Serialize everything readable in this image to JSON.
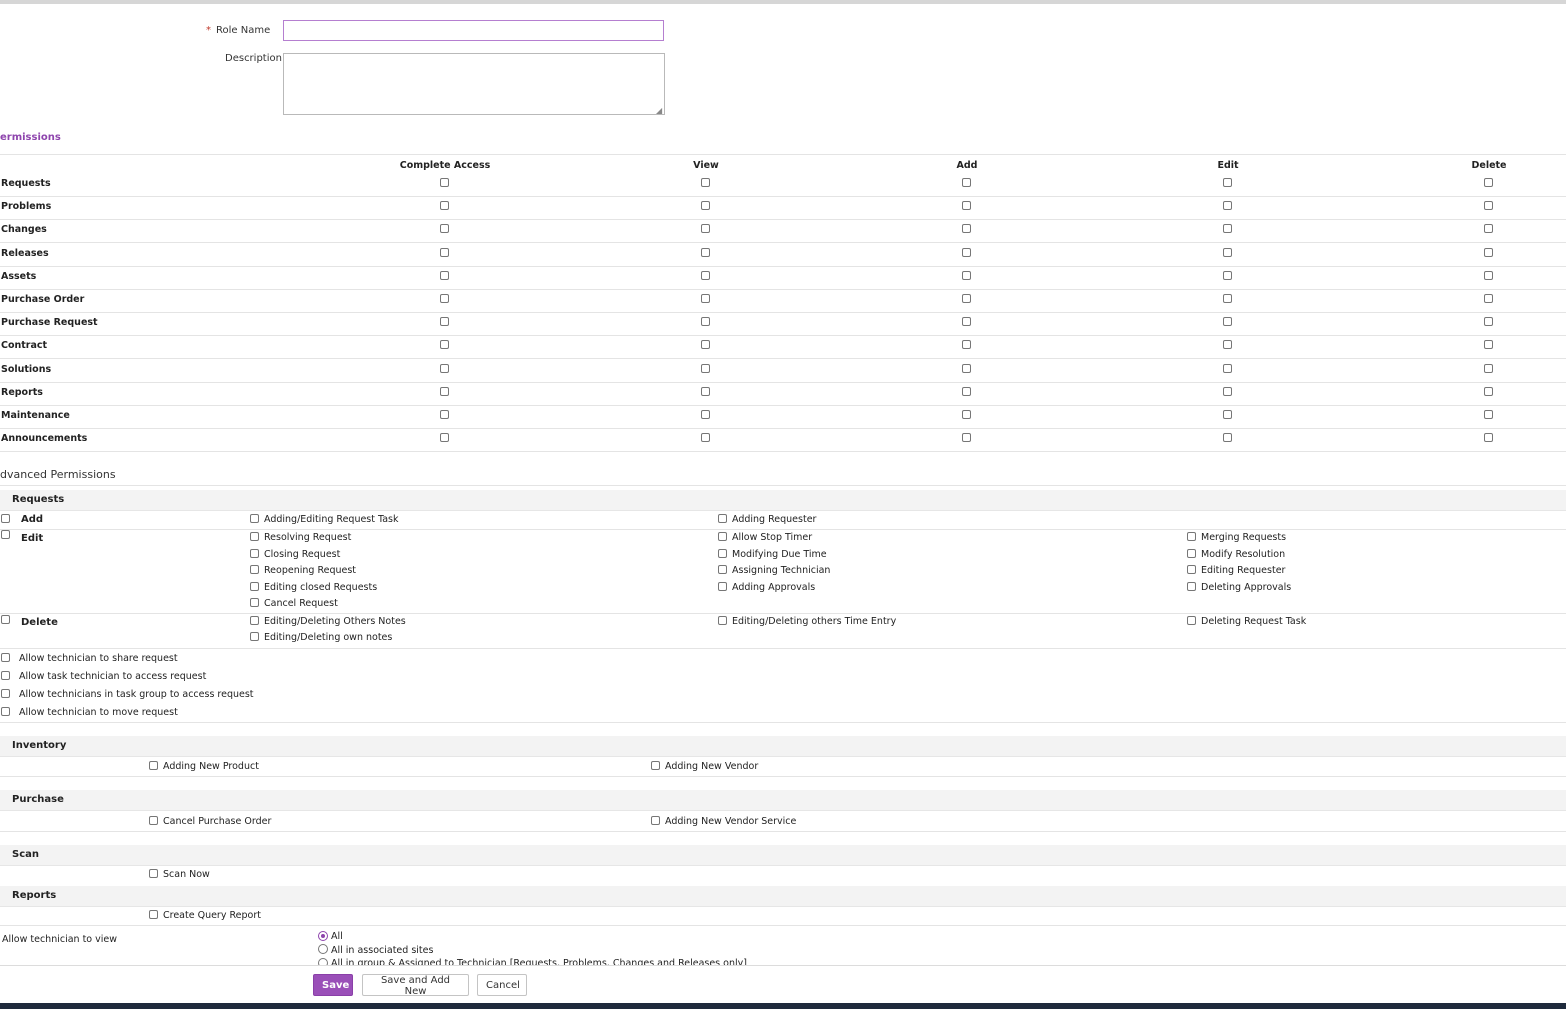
{
  "form": {
    "role_name_required": "*",
    "role_name_label": "Role Name",
    "role_name_value": "",
    "description_label": "Description",
    "description_value": ""
  },
  "permissions": {
    "title": "ermissions",
    "columns": [
      "Complete Access",
      "View",
      "Add",
      "Edit",
      "Delete"
    ],
    "modules": [
      "Requests",
      "Problems",
      "Changes",
      "Releases",
      "Assets",
      "Purchase Order",
      "Purchase Request",
      "Contract",
      "Solutions",
      "Reports",
      "Maintenance",
      "Announcements"
    ]
  },
  "advanced": {
    "title": "dvanced Permissions",
    "requests": {
      "title": "Requests",
      "add_label": "Add",
      "add_items": [
        "Adding/Editing Request Task",
        "Adding Requester"
      ],
      "edit_label": "Edit",
      "edit_col1": [
        "Resolving Request",
        "Closing Request",
        "Reopening Request",
        "Editing closed Requests",
        "Cancel Request"
      ],
      "edit_col2": [
        "Allow Stop Timer",
        "Modifying Due Time",
        "Assigning Technician",
        "Adding Approvals"
      ],
      "edit_col3": [
        "Merging Requests",
        "Modify Resolution",
        "Editing Requester",
        "Deleting Approvals"
      ],
      "delete_label": "Delete",
      "delete_col1": [
        "Editing/Deleting Others Notes",
        "Editing/Deleting own notes"
      ],
      "delete_col2": [
        "Editing/Deleting others Time Entry"
      ],
      "delete_col3": [
        "Deleting Request Task"
      ],
      "extra": [
        "Allow technician to share request",
        "Allow task technician to access request",
        "Allow technicians in task group to access request",
        "Allow technician to move request"
      ]
    },
    "inventory": {
      "title": "Inventory",
      "items": [
        "Adding New Product",
        "Adding New Vendor"
      ]
    },
    "purchase": {
      "title": "Purchase",
      "items": [
        "Cancel Purchase Order",
        "Adding New Vendor Service"
      ]
    },
    "scan": {
      "title": "Scan",
      "items": [
        "Scan Now"
      ]
    },
    "reports": {
      "title": "Reports",
      "items": [
        "Create Query Report"
      ]
    },
    "view_scope": {
      "label": "Allow technician to view",
      "options": [
        "All",
        "All in associated sites",
        "All in group & Assigned to Technician [Requests, Problems, Changes and Releases only]"
      ],
      "selected": "All"
    }
  },
  "buttons": {
    "save": "Save",
    "save_add_new": "Save and Add New",
    "cancel": "Cancel"
  },
  "colors": {
    "accent": "#9a4fb8"
  }
}
